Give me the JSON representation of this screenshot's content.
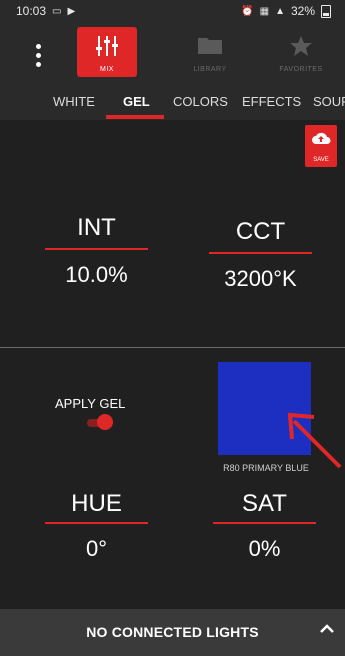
{
  "status_bar": {
    "time": "10:03",
    "battery": "32%"
  },
  "header": {
    "buttons": [
      {
        "label": "MIX",
        "icon": "sliders-icon",
        "active": true
      },
      {
        "label": "LIBRARY",
        "icon": "folder-icon",
        "active": false
      },
      {
        "label": "FAVORITES",
        "icon": "star-icon",
        "active": false
      }
    ]
  },
  "tabs": [
    {
      "label": "WHITE"
    },
    {
      "label": "GEL",
      "active": true
    },
    {
      "label": "COLORS"
    },
    {
      "label": "EFFECTS"
    },
    {
      "label": "SOUR"
    }
  ],
  "save": {
    "label": "SAVE",
    "icon": "cloud-upload-icon"
  },
  "controls": {
    "int": {
      "label": "INT",
      "value": "10.0%"
    },
    "cct": {
      "label": "CCT",
      "value": "3200°K"
    },
    "hue": {
      "label": "HUE",
      "value": "0°"
    },
    "sat": {
      "label": "SAT",
      "value": "0%"
    }
  },
  "apply_gel": {
    "label": "APPLY GEL",
    "on": true
  },
  "gel": {
    "name": "R80 PRIMARY BLUE",
    "color": "#1c2fc0"
  },
  "footer": {
    "label": "NO CONNECTED LIGHTS",
    "icon": "chevron-up-icon"
  },
  "colors": {
    "accent": "#e02727",
    "background": "#202020"
  }
}
